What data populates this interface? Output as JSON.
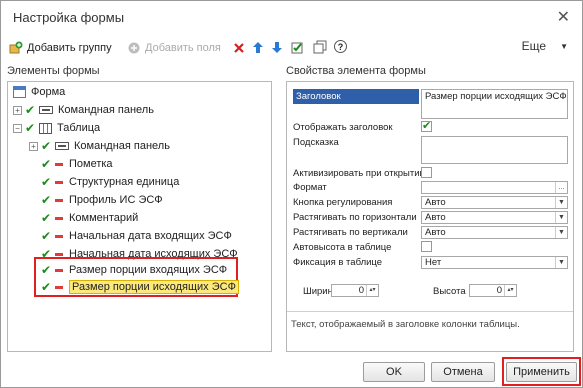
{
  "window": {
    "title": "Настройка формы",
    "close_glyph": "✕"
  },
  "toolbar": {
    "add_group": "Добавить группу",
    "add_field": "Добавить поля",
    "more": "Еще",
    "help_glyph": "?"
  },
  "left_panel": {
    "label": "Элементы формы",
    "tree": [
      {
        "text": "Форма"
      },
      {
        "text": "Командная панель"
      },
      {
        "text": "Таблица"
      },
      {
        "text": "Командная панель"
      },
      {
        "text": "Пометка"
      },
      {
        "text": "Структурная единица"
      },
      {
        "text": "Профиль ИС ЭСФ"
      },
      {
        "text": "Комментарий"
      },
      {
        "text": "Начальная дата входящих ЭСФ"
      },
      {
        "text": "Начальная дата исходящих ЭСФ"
      },
      {
        "text": "Размер порции входящих ЭСФ"
      },
      {
        "text": "Размер порции исходящих ЭСФ"
      }
    ]
  },
  "right_panel": {
    "label": "Свойства элемента формы",
    "header_label": "Заголовок",
    "header_value": "Размер порции исходящих ЭСФ",
    "show_header": "Отображать заголовок",
    "tooltip": "Подсказка",
    "activate_on_open": "Активизировать при открытии",
    "format": "Формат",
    "adjust_button": "Кнопка регулирования",
    "adjust_button_value": "Авто",
    "stretch_h": "Растягивать по горизонтали",
    "stretch_h_value": "Авто",
    "stretch_v": "Растягивать по вертикали",
    "stretch_v_value": "Авто",
    "auto_height": "Автовысота в таблице",
    "fixation": "Фиксация в таблице",
    "fixation_value": "Нет",
    "width_label": "Ширина",
    "width_value": "0",
    "height_label": "Высота",
    "height_value": "0",
    "hint": "Текст, отображаемый в заголовке колонки таблицы.",
    "ellipsis": "..."
  },
  "buttons": {
    "ok": "OK",
    "cancel": "Отмена",
    "apply": "Применить"
  }
}
